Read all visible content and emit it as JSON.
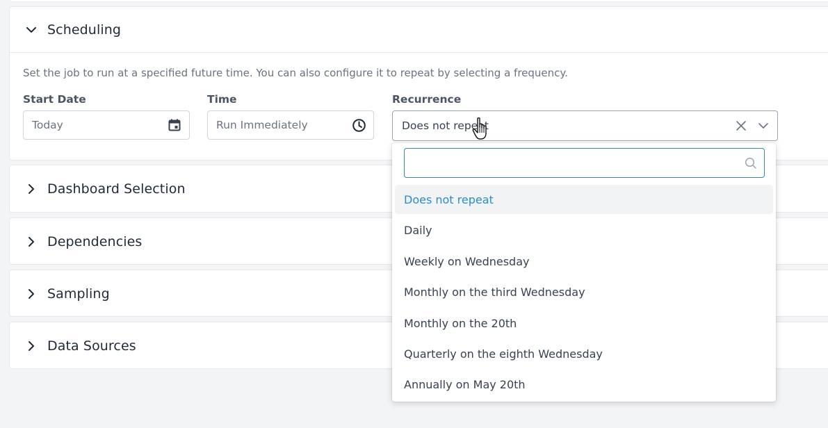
{
  "scheduling": {
    "title": "Scheduling",
    "description": "Set the job to run at a specified future time. You can also configure it to repeat by selecting a frequency.",
    "start_date": {
      "label": "Start Date",
      "placeholder": "Today"
    },
    "time": {
      "label": "Time",
      "placeholder": "Run Immediately"
    },
    "recurrence": {
      "label": "Recurrence",
      "value": "Does not repeat",
      "search_value": "",
      "options": [
        "Does not repeat",
        "Daily",
        "Weekly on Wednesday",
        "Monthly on the third Wednesday",
        "Monthly on the 20th",
        "Quarterly on the eighth Wednesday",
        "Annually on May 20th"
      ]
    }
  },
  "sections": [
    {
      "title": "Dashboard Selection"
    },
    {
      "title": "Dependencies"
    },
    {
      "title": "Sampling"
    },
    {
      "title": "Data Sources"
    }
  ],
  "colors": {
    "accent": "#2b8ab7",
    "selected_text": "#2b8ccc"
  },
  "icons": {
    "calendar": "calendar-icon",
    "clock": "clock-icon",
    "clear": "close-icon",
    "dropdown": "chevron-down-icon",
    "search": "search-icon",
    "expanded": "chevron-down-icon",
    "collapsed": "chevron-right-icon"
  }
}
